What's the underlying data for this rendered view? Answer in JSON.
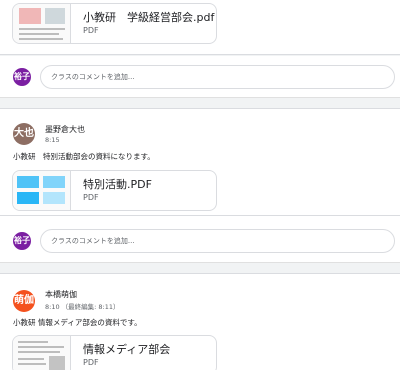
{
  "posts": [
    {
      "author": "",
      "time": "",
      "text": "",
      "attachment": {
        "title": "小教研　学級経営部会.pdf",
        "type": "PDF",
        "thumb": "document-thumbnail"
      }
    },
    {
      "author": "墨野倉大也",
      "avatar_text": "大也",
      "avatar_color": "#8d6e63",
      "time": "8:15",
      "text": "小教研　特別活動部会の資料になります。",
      "attachment": {
        "title": "特別活動.PDF",
        "type": "PDF",
        "thumb": "slide-thumbnail"
      }
    },
    {
      "author": "本橋萌伽",
      "avatar_text": "萌伽",
      "avatar_color": "#f4511e",
      "time": "8:10 （最終編集: 8:11）",
      "text": "小教研 情報メディア部会の資料です。",
      "attachment": {
        "title": "情報メディア部会",
        "type": "PDF",
        "thumb": "document-thumbnail"
      }
    }
  ],
  "comment_box": {
    "avatar_text": "裕子",
    "avatar_color": "#7b1fa2",
    "placeholder": "クラスのコメントを追加..."
  }
}
